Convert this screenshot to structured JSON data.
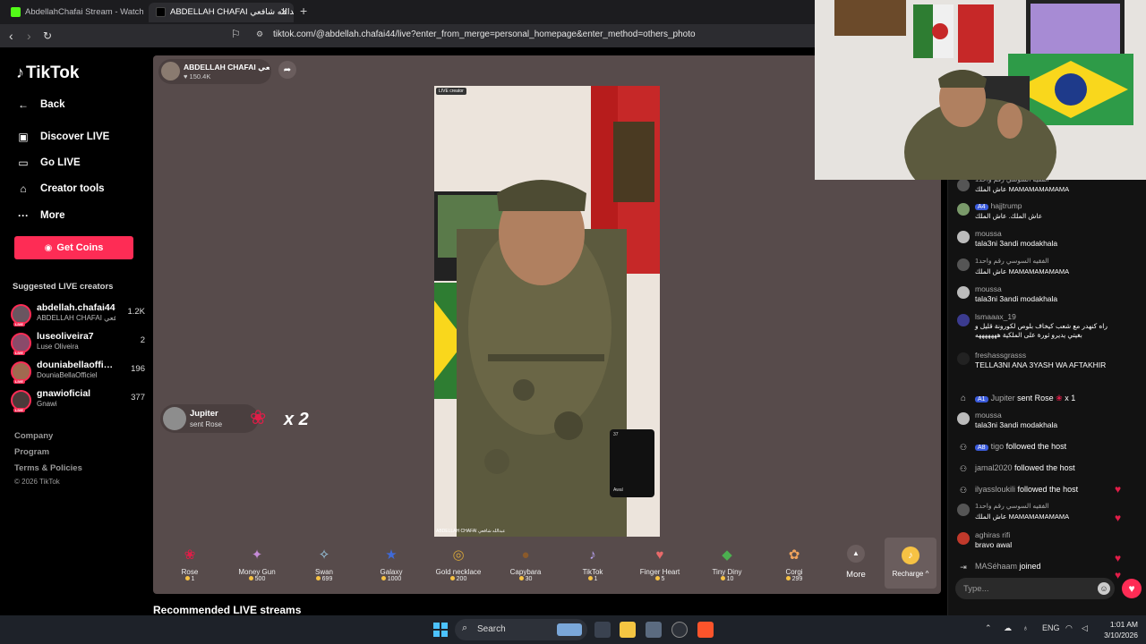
{
  "browser": {
    "tabs": [
      {
        "title": "AbdellahChafai Stream - Watch Live on Kick",
        "favicon_color": "#53fc18"
      },
      {
        "title": "ABDELLAH CHAFAI عبدالله شافعي",
        "favicon_color": "#000000"
      }
    ],
    "url": "tiktok.com/@abdellah.chafai44/live?enter_from_merge=personal_homepage&enter_method=others_photo"
  },
  "sidebar": {
    "logo": "TikTok",
    "nav": [
      {
        "label": "Back",
        "icon": "arrow-left-icon"
      },
      {
        "label": "Discover LIVE",
        "icon": "calendar-icon"
      },
      {
        "label": "Go LIVE",
        "icon": "camera-icon"
      },
      {
        "label": "Creator tools",
        "icon": "home-icon"
      },
      {
        "label": "More",
        "icon": "dots-icon"
      }
    ],
    "get_coins": "Get Coins",
    "suggested_title": "Suggested LIVE creators",
    "creators": [
      {
        "name": "abdellah.chafai44",
        "sub": "ABDELLAH CHAFAI عبدالله شافعي",
        "count": "1.2K"
      },
      {
        "name": "luseoliveira7",
        "sub": "Luse Oliveira",
        "count": "2"
      },
      {
        "name": "douniabellaofficiel",
        "sub": "DouniaBellaOfficiel",
        "count": "196"
      },
      {
        "name": "gnawioficial",
        "sub": "Gnawi",
        "count": "377"
      }
    ],
    "footer": [
      "Company",
      "Program",
      "Terms & Policies"
    ],
    "copyright": "© 2026 TikTok",
    "live_badge": "LIVE"
  },
  "stream": {
    "host_name": "ABDELLAH CHAFAI عبدالله شافعي",
    "viewers": "150.4K",
    "live_badge": "LIVE creator",
    "video_caption": "ABDELLAH CHAFAI عبدالله شافعي",
    "pip_count": "37",
    "pip_label": "Awal",
    "gift_notice": {
      "user": "Jupiter",
      "action": "sent Rose",
      "multiplier": "x 2"
    },
    "gifts": [
      {
        "name": "Rose",
        "price": "1",
        "icon": "rose-icon",
        "color": "#e11d48",
        "glyph": "❀"
      },
      {
        "name": "Money Gun",
        "price": "500",
        "icon": "money-gun-icon",
        "color": "#c58bd6",
        "glyph": "✦"
      },
      {
        "name": "Swan",
        "price": "699",
        "icon": "swan-icon",
        "color": "#9fd3f0",
        "glyph": "✧"
      },
      {
        "name": "Galaxy",
        "price": "1000",
        "icon": "galaxy-icon",
        "color": "#3f6ad8",
        "glyph": "★"
      },
      {
        "name": "Gold necklace",
        "price": "200",
        "icon": "necklace-icon",
        "color": "#d4a43a",
        "glyph": "◎"
      },
      {
        "name": "Capybara",
        "price": "30",
        "icon": "capybara-icon",
        "color": "#8a5a2b",
        "glyph": "●"
      },
      {
        "name": "TikTok",
        "price": "1",
        "icon": "tiktok-icon",
        "color": "#7c5cd6",
        "glyph": "♪"
      },
      {
        "name": "Finger Heart",
        "price": "5",
        "icon": "finger-heart-icon",
        "color": "#e86a6a",
        "glyph": "♥"
      },
      {
        "name": "Tiny Diny",
        "price": "10",
        "icon": "dinosaur-icon",
        "color": "#4caf50",
        "glyph": "◆"
      },
      {
        "name": "Corgi",
        "price": "299",
        "icon": "corgi-icon",
        "color": "#f0a35c",
        "glyph": "✿"
      }
    ],
    "more_label": "More",
    "recharge_label": "Recharge ^",
    "recommended_title": "Recommended LIVE streams"
  },
  "chat": {
    "messages": [
      {
        "user": "الفقيه السوسي رقم واحد1",
        "text": "عاش الملك MAMAMAMAMAMA"
      },
      {
        "user": "hajjtrump",
        "level": "4",
        "text": "عاش الملك. عاش الملك"
      },
      {
        "user": "moussa",
        "text": "tala3ni 3andi modakhala"
      },
      {
        "user": "الفقيه السوسي رقم واحد1",
        "text": "عاش الملك MAMAMAMAMAMA"
      },
      {
        "user": "moussa",
        "text": "tala3ni 3andi modakhala"
      },
      {
        "user": "lsmaaax_19",
        "text": "راه كنهدر مع شعب كيخاف بلوص لكورونة قليل و بغيتي يديرو ثورة على الملكية هههههههه"
      },
      {
        "user": "freshassgrasss",
        "text": "TELLA3NI ANA 3YASH WA AFTAKHIR"
      },
      {
        "user": "Jupiter",
        "level": "1",
        "text": "sent Rose",
        "suffix": "x 1"
      },
      {
        "user": "moussa",
        "text": "tala3ni 3andi modakhala"
      },
      {
        "user": "tigo",
        "level": "8",
        "text": "followed the host"
      },
      {
        "user": "jamal2020",
        "text": "followed the host"
      },
      {
        "user": "ilyassloukili",
        "text": "followed the host"
      },
      {
        "user": "الفقيه السوسي رقم واحد1",
        "text": "عاش الملك MAMAMAMAMAMA"
      },
      {
        "user": "aghiras rifi",
        "text": "bravo awal"
      },
      {
        "user": "MASéhaam",
        "text": "joined"
      }
    ],
    "input_placeholder": "Type..."
  },
  "taskbar": {
    "search_label": "Search",
    "lang": "ENG",
    "time": "1:01 AM",
    "date": "3/10/2026"
  }
}
